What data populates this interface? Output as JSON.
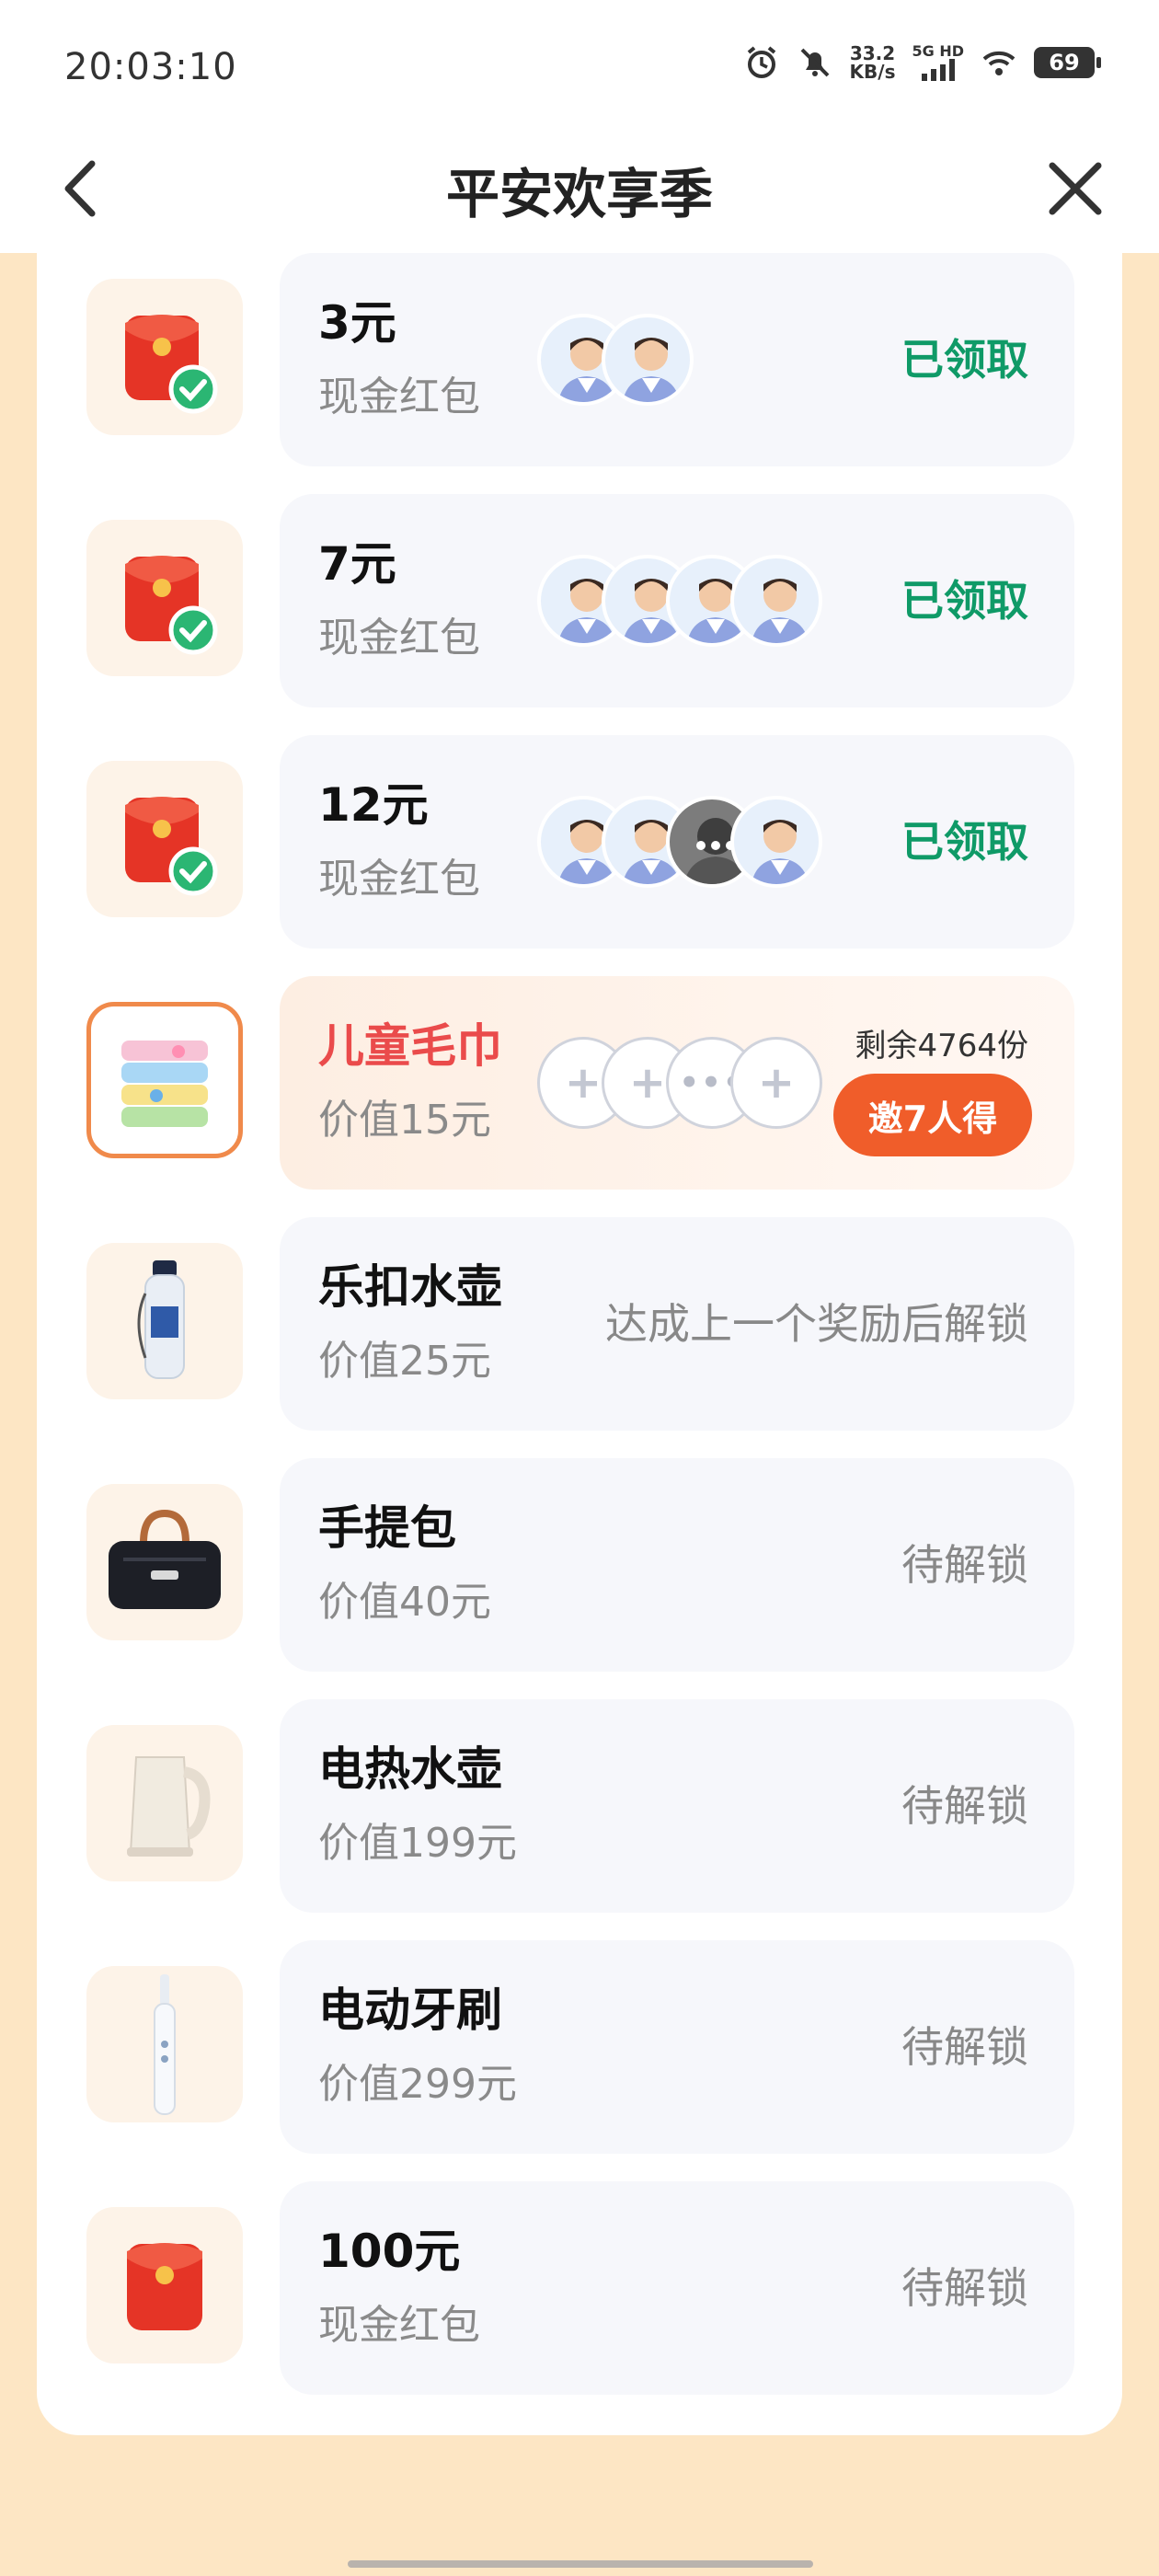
{
  "status_bar": {
    "time": "20:03:10",
    "net_speed_top": "33.2",
    "net_speed_unit": "KB/s",
    "signal_label": "5G HD",
    "battery": "69"
  },
  "nav": {
    "title": "平安欢享季"
  },
  "colors": {
    "page_bg": "#fde6c4",
    "claimed_green": "#0f9a67",
    "accent_red": "#ea4b4b",
    "button_orange": "#f05d2a"
  },
  "rewards": [
    {
      "title": "3元",
      "sub": "现金红包",
      "status": "已领取",
      "icon": "red-envelope-checked-icon"
    },
    {
      "title": "7元",
      "sub": "现金红包",
      "status": "已领取",
      "icon": "red-envelope-checked-icon"
    },
    {
      "title": "12元",
      "sub": "现金红包",
      "status": "已领取",
      "icon": "red-envelope-checked-icon"
    },
    {
      "title": "儿童毛巾",
      "sub": "价值15元",
      "remaining": "剩余4764份",
      "button": "邀7人得",
      "icon": "towel-icon"
    },
    {
      "title": "乐扣水壶",
      "sub": "价值25元",
      "status": "达成上一个奖励后解锁",
      "icon": "water-bottle-icon"
    },
    {
      "title": "手提包",
      "sub": "价值40元",
      "status": "待解锁",
      "icon": "handbag-icon"
    },
    {
      "title": "电热水壶",
      "sub": "价值199元",
      "status": "待解锁",
      "icon": "electric-kettle-icon"
    },
    {
      "title": "电动牙刷",
      "sub": "价值299元",
      "status": "待解锁",
      "icon": "toothbrush-icon"
    },
    {
      "title": "100元",
      "sub": "现金红包",
      "status": "待解锁",
      "icon": "red-envelope-icon"
    }
  ]
}
